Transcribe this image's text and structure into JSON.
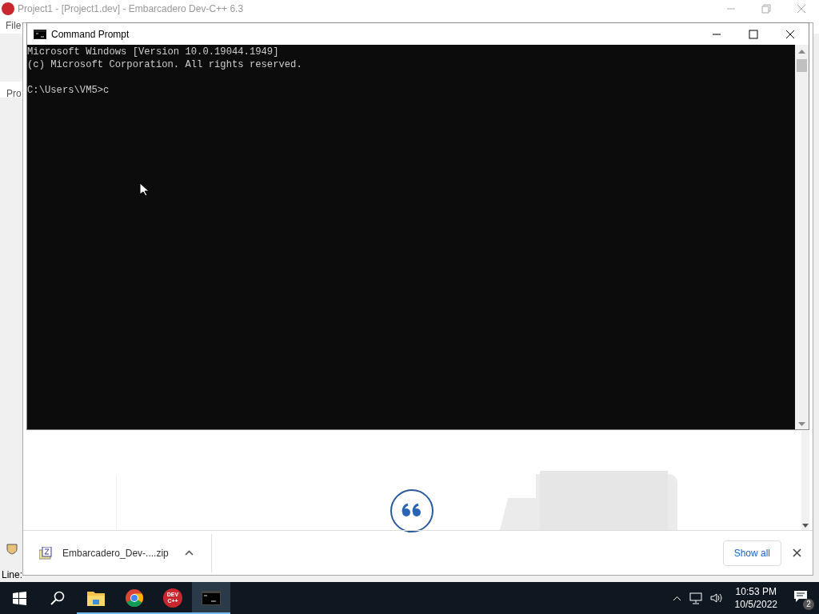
{
  "background_window": {
    "title": "Project1 - [Project1.dev] - Embarcadero Dev-C++ 6.3",
    "menu": [
      "File"
    ],
    "panel_tab": "Pro",
    "status_bar": [
      "Line:"
    ]
  },
  "browser": {
    "downloads": [
      {
        "file": "Embarcadero_Dev-....zip"
      }
    ],
    "show_all": "Show all"
  },
  "console": {
    "title": "Command Prompt",
    "banner": [
      "Microsoft Windows [Version 10.0.19044.1949]",
      "(c) Microsoft Corporation. All rights reserved."
    ],
    "prompt": "C:\\Users\\VM5>c"
  },
  "taskbar": {
    "items": [
      {
        "kind": "start",
        "running": false,
        "selected": false
      },
      {
        "kind": "search",
        "running": false,
        "selected": false
      },
      {
        "kind": "explorer",
        "running": true,
        "selected": false
      },
      {
        "kind": "chrome",
        "running": true,
        "selected": false
      },
      {
        "kind": "devcpp",
        "label": "DEV C++",
        "running": true,
        "selected": false
      },
      {
        "kind": "cmd",
        "running": true,
        "selected": true
      }
    ],
    "time": "10:53 PM",
    "date": "10/5/2022",
    "notifications": "2"
  }
}
